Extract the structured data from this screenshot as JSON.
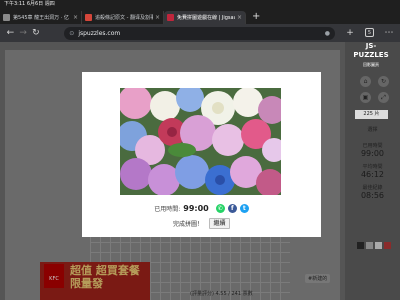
{
  "status_bar": {
    "time": "下午3:11  6月6日 週四"
  },
  "tabs": [
    {
      "title": "第545章 龍王出洞万 · 亿",
      "favicon_color": "#8a8a8a",
      "active": false
    },
    {
      "title": "追殺條記原文 - 翻译及割事",
      "favicon_color": "#d5463a",
      "active": false
    },
    {
      "title": "免費拼圖遊戲在線 | Jigsaw Puzzles",
      "favicon_color": "#c0263c",
      "active": true
    }
  ],
  "toolbar": {
    "url": "jspuzzles.com",
    "tab_count": "5"
  },
  "sidebar": {
    "logo": "JS-PUZZLES",
    "logo_sub": "回影圖頁",
    "pieces": "225 片",
    "labels": {
      "choose": "選擇",
      "used_time": "已用時間",
      "used_time_value": "99:00",
      "avg_time": "平均時間",
      "avg_time_value": "46:12",
      "best_record": "最佳紀錄",
      "best_record_value": "08:56"
    }
  },
  "page": {
    "ad_text": "超值 超買套餐限量發",
    "ad_brand": "KFC",
    "rating_text": "(評量評分) 4.55 / 241 票數",
    "tag": "#新建的"
  },
  "modal": {
    "time_label": "已用時間:",
    "time_value": "99:00",
    "complete_text": "完成拼圖！",
    "continue_label": "繼續"
  },
  "colors": {
    "facebook": "#3b5998",
    "twitter": "#1da1f2",
    "whatsapp": "#25d366"
  }
}
